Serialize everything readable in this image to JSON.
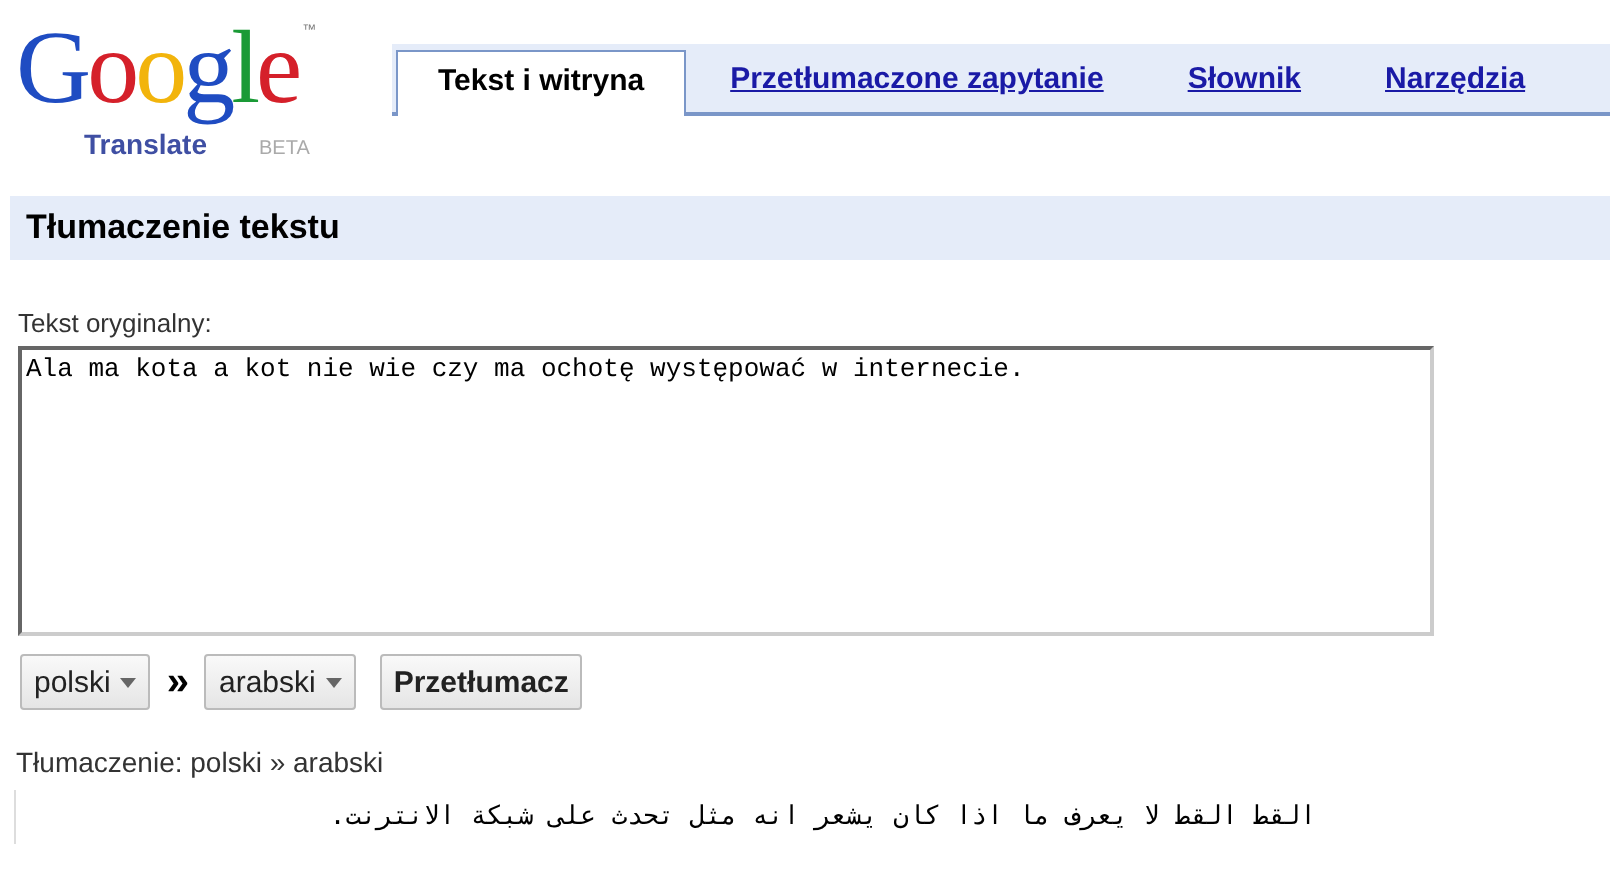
{
  "logo": {
    "wordmark": "Google",
    "tm": "™",
    "product": "Translate",
    "badge": "BETA"
  },
  "tabs": [
    {
      "label": "Tekst i witryna",
      "selected": true
    },
    {
      "label": "Przetłumaczone zapytanie",
      "selected": false
    },
    {
      "label": "Słownik",
      "selected": false
    },
    {
      "label": "Narzędzia",
      "selected": false
    }
  ],
  "section_title": "Tłumaczenie tekstu",
  "source": {
    "label": "Tekst oryginalny:",
    "value": "Ala ma kota a kot nie wie czy ma ochotę występować w internecie."
  },
  "controls": {
    "from": "polski",
    "separator": "»",
    "to": "arabski",
    "button": "Przetłumacz"
  },
  "result": {
    "label": "Tłumaczenie: polski » arabski",
    "text": "القط القط لا يعرف ما اذا كان يشعر انه مثل تحدث على شبكة الانترنت."
  }
}
